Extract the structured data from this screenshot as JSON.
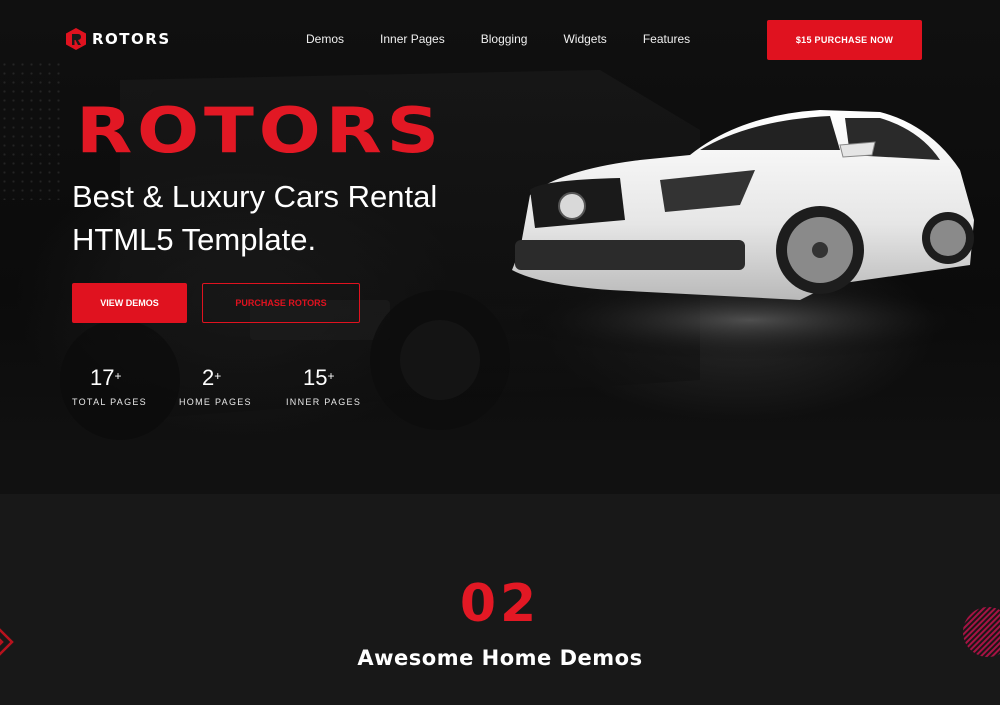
{
  "brand": {
    "name": "ROTORS",
    "accent": "#e0121f"
  },
  "nav": {
    "items": [
      "Demos",
      "Inner Pages",
      "Blogging",
      "Widgets",
      "Features"
    ],
    "cta_label": "$15 PURCHASE NOW"
  },
  "hero": {
    "title": "ROTORS",
    "headline": "Best & Luxury Cars Rental HTML5 Template.",
    "primary_button": "VIEW DEMOS",
    "secondary_button": "PURCHASE ROTORS",
    "stats": [
      {
        "value": "17",
        "suffix": "+",
        "label": "TOTAL PAGES"
      },
      {
        "value": "2",
        "suffix": "+",
        "label": "HOME PAGES"
      },
      {
        "value": "15",
        "suffix": "+",
        "label": "INNER PAGES"
      }
    ]
  },
  "demos_section": {
    "number": "02",
    "title": "Awesome Home Demos"
  }
}
